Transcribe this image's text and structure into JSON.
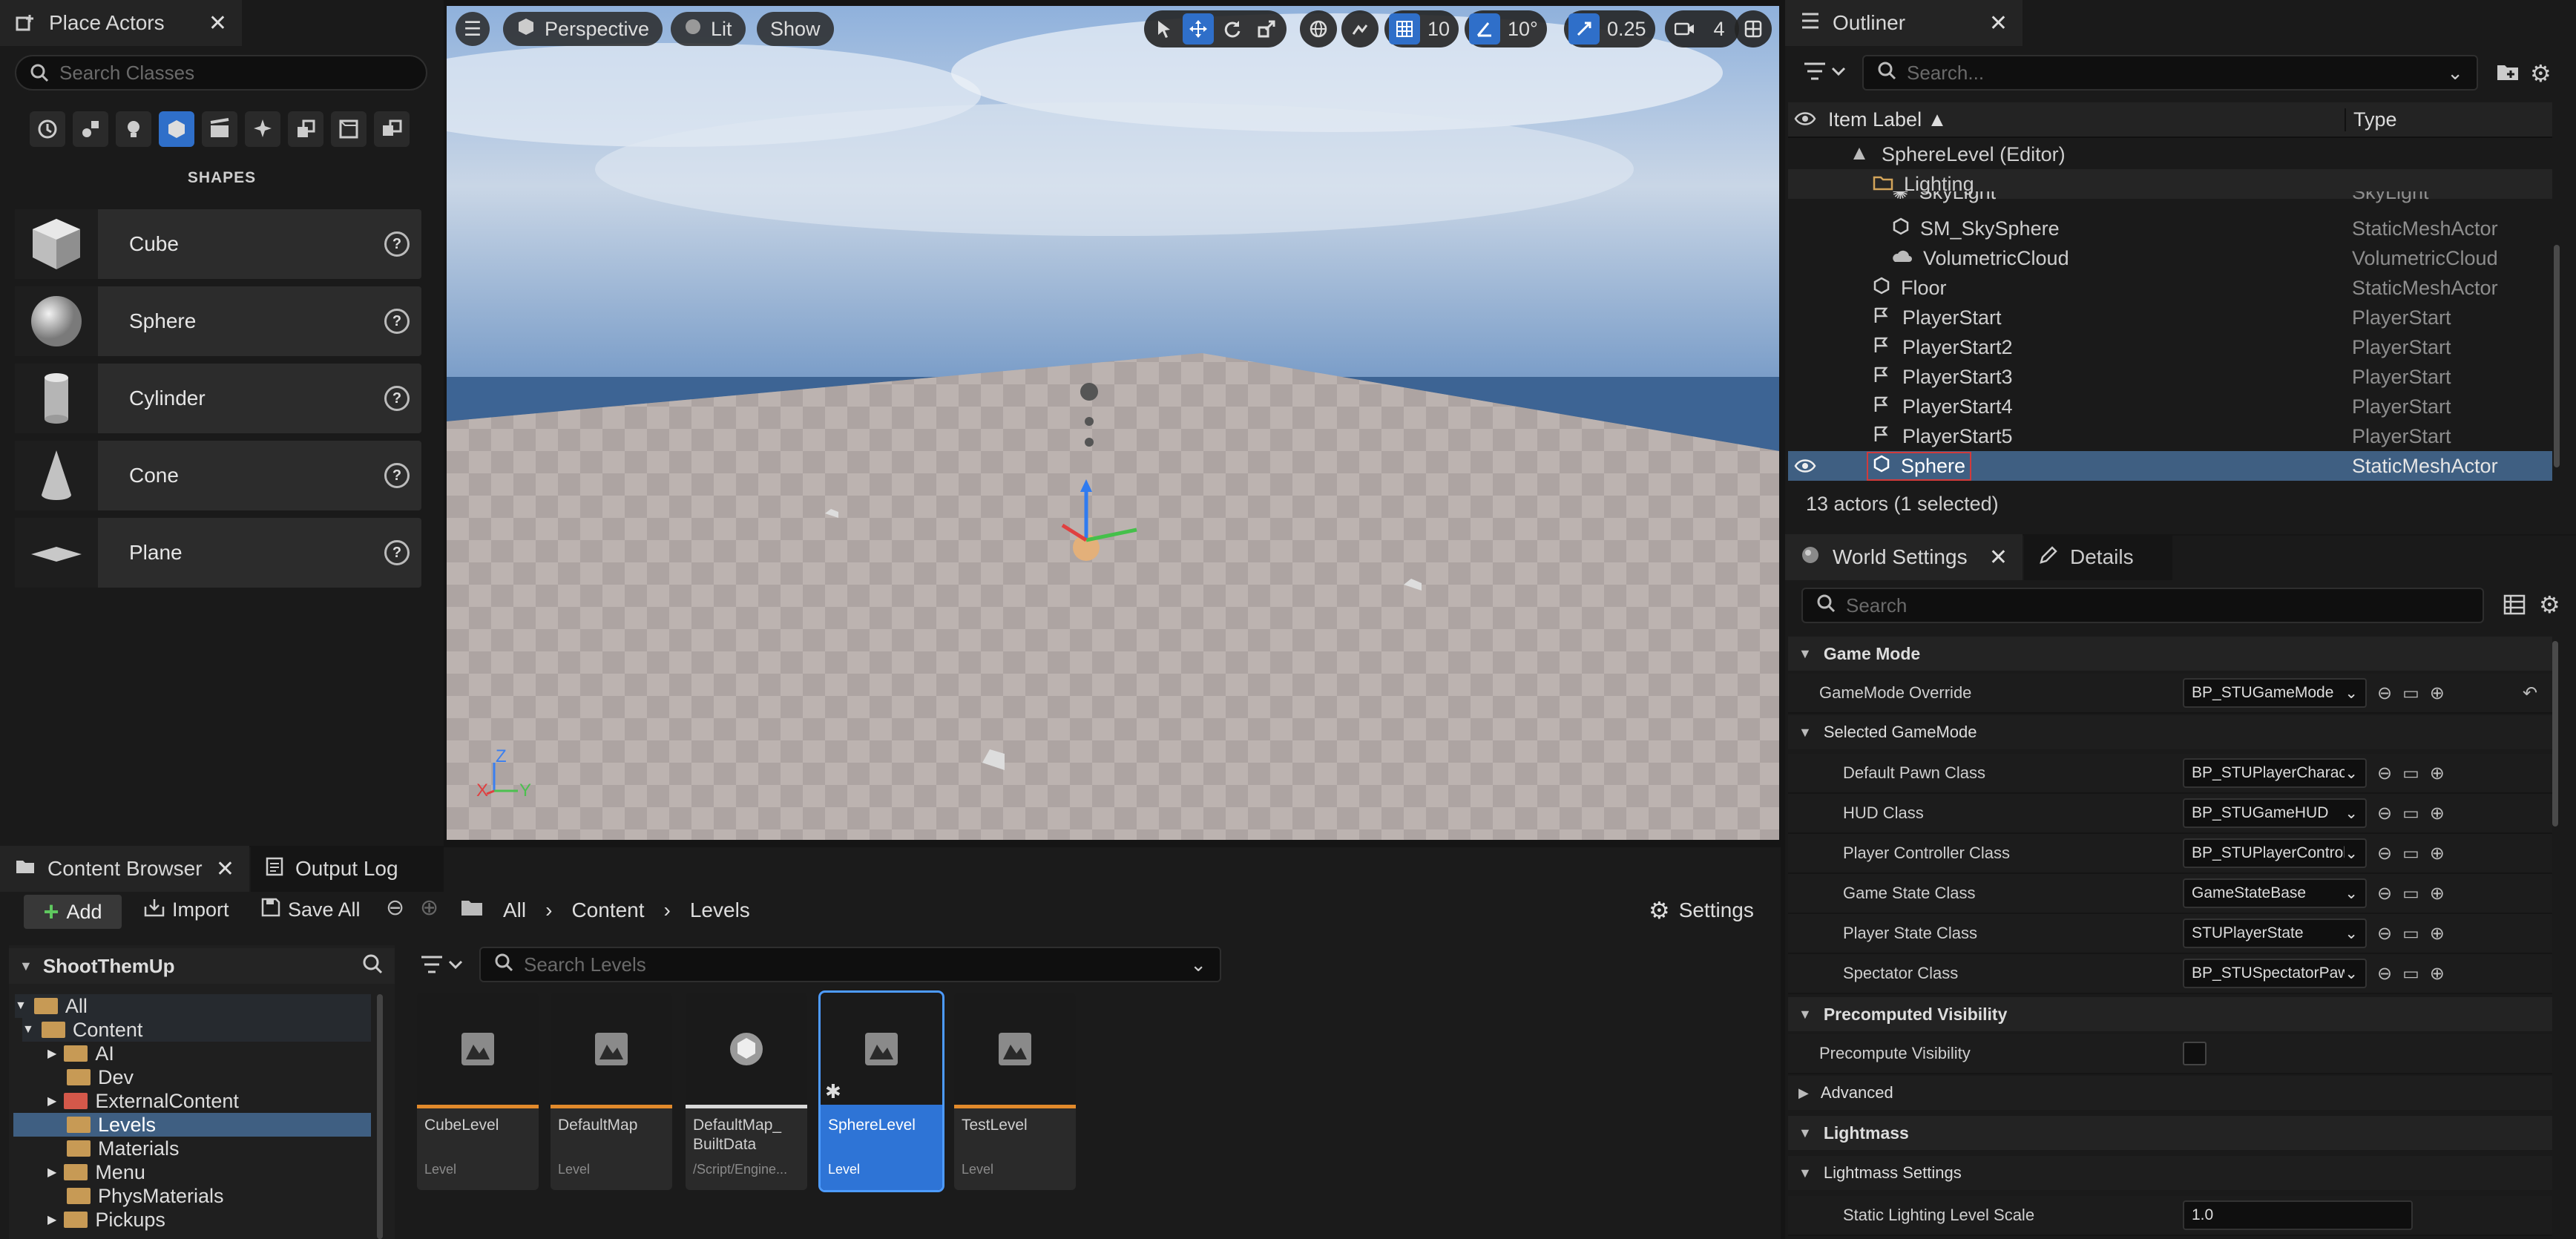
{
  "place_actors": {
    "tab_title": "Place Actors",
    "search_placeholder": "Search Classes",
    "section_label": "SHAPES",
    "items": [
      {
        "label": "Cube"
      },
      {
        "label": "Sphere"
      },
      {
        "label": "Cylinder"
      },
      {
        "label": "Cone"
      },
      {
        "label": "Plane"
      }
    ]
  },
  "viewport": {
    "perspective_label": "Perspective",
    "lit_label": "Lit",
    "show_label": "Show",
    "grid_snap": "10",
    "angle_snap": "10°",
    "scale_snap": "0.25",
    "camera_speed": "4",
    "axis_labels": {
      "z": "Z",
      "x": "X",
      "y": "Y"
    }
  },
  "outliner": {
    "tab_title": "Outliner",
    "search_placeholder": "Search...",
    "col_label": "Item Label ▲",
    "col_type": "Type",
    "rows": [
      {
        "label": "SphereLevel (Editor)",
        "type": ""
      },
      {
        "label": "Lighting",
        "type": ""
      },
      {
        "label": "SkyLight",
        "type": "SkyLight"
      },
      {
        "label": "SM_SkySphere",
        "type": "StaticMeshActor"
      },
      {
        "label": "VolumetricCloud",
        "type": "VolumetricCloud"
      },
      {
        "label": "Floor",
        "type": "StaticMeshActor"
      },
      {
        "label": "PlayerStart",
        "type": "PlayerStart"
      },
      {
        "label": "PlayerStart2",
        "type": "PlayerStart"
      },
      {
        "label": "PlayerStart3",
        "type": "PlayerStart"
      },
      {
        "label": "PlayerStart4",
        "type": "PlayerStart"
      },
      {
        "label": "PlayerStart5",
        "type": "PlayerStart"
      },
      {
        "label": "Sphere",
        "type": "StaticMeshActor"
      }
    ],
    "status": "13 actors (1 selected)"
  },
  "details": {
    "tab_world": "World Settings",
    "tab_details": "Details",
    "search_placeholder": "Search",
    "sections": {
      "game_mode": "Game Mode",
      "selected_game_mode": "Selected GameMode",
      "precomputed_visibility": "Precomputed Visibility",
      "advanced": "Advanced",
      "lightmass": "Lightmass",
      "lightmass_settings": "Lightmass Settings"
    },
    "props": {
      "gamemode_override": {
        "label": "GameMode Override",
        "value": "BP_STUGameMode"
      },
      "default_pawn": {
        "label": "Default Pawn Class",
        "value": "BP_STUPlayerCharacter"
      },
      "hud": {
        "label": "HUD Class",
        "value": "BP_STUGameHUD"
      },
      "player_controller": {
        "label": "Player Controller Class",
        "value": "BP_STUPlayerController"
      },
      "game_state": {
        "label": "Game State Class",
        "value": "GameStateBase"
      },
      "player_state": {
        "label": "Player State Class",
        "value": "STUPlayerState"
      },
      "spectator": {
        "label": "Spectator Class",
        "value": "BP_STUSpectatorPawn"
      },
      "precompute_visibility": {
        "label": "Precompute Visibility"
      },
      "static_lighting_scale": {
        "label": "Static Lighting Level Scale",
        "value": "1.0"
      }
    }
  },
  "content_browser": {
    "tab_title": "Content Browser",
    "output_log": "Output Log",
    "add_label": "Add",
    "import_label": "Import",
    "save_all_label": "Save All",
    "settings_label": "Settings",
    "breadcrumb": [
      "All",
      "Content",
      "Levels"
    ],
    "project_name": "ShootThemUp",
    "search_placeholder": "Search Levels",
    "tree": [
      {
        "label": "All"
      },
      {
        "label": "Content"
      },
      {
        "label": "AI"
      },
      {
        "label": "Dev"
      },
      {
        "label": "ExternalContent"
      },
      {
        "label": "Levels"
      },
      {
        "label": "Materials"
      },
      {
        "label": "Menu"
      },
      {
        "label": "PhysMaterials"
      },
      {
        "label": "Pickups"
      }
    ],
    "assets": [
      {
        "name": "CubeLevel",
        "type": "Level"
      },
      {
        "name": "DefaultMap",
        "type": "Level"
      },
      {
        "name": "DefaultMap_ BuiltData",
        "type": "/Script/Engine..."
      },
      {
        "name": "SphereLevel",
        "type": "Level"
      },
      {
        "name": "TestLevel",
        "type": "Level"
      }
    ]
  }
}
